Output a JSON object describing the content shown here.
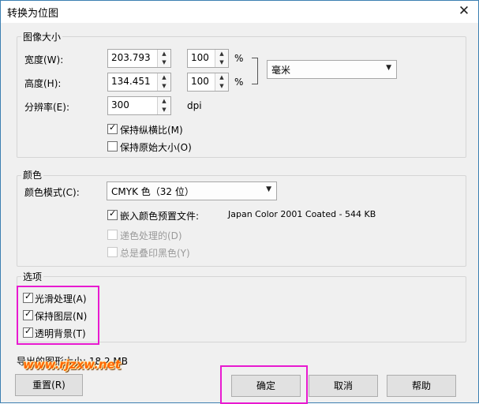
{
  "dialog": {
    "title": "转换为位图",
    "close_glyph": "✕"
  },
  "image_size": {
    "group_title": "图像大小",
    "width_label": "宽度(W):",
    "width_value": "203.793",
    "width_percent": "100",
    "height_label": "高度(H):",
    "height_value": "134.451",
    "height_percent": "100",
    "percent_sign": "%",
    "unit_value": "毫米",
    "resolution_label": "分辨率(E):",
    "resolution_value": "300",
    "resolution_unit": "dpi",
    "keep_ratio_label": "保持纵横比(M)",
    "keep_ratio_checked": true,
    "keep_original_label": "保持原始大小(O)",
    "keep_original_checked": false
  },
  "color": {
    "group_title": "颜色",
    "mode_label": "颜色模式(C):",
    "mode_value": "CMYK 色（32 位）",
    "embed_profile_label": "嵌入颜色预置文件:",
    "embed_profile_checked": true,
    "profile_name": "Japan Color 2001 Coated - 544 KB",
    "dither_label": "递色处理的(D)",
    "dither_checked": false,
    "overprint_label": "总是叠印黑色(Y)",
    "overprint_checked": false
  },
  "options": {
    "group_title": "选项",
    "smooth_label": "光滑处理(A)",
    "smooth_checked": true,
    "keep_layers_label": "保持图层(N)",
    "keep_layers_checked": true,
    "transparent_label": "透明背景(T)",
    "transparent_checked": true
  },
  "export_size_text": "导出的图形大小: 18.2 MB",
  "watermark_text": "www.rjzxw.net",
  "buttons": {
    "reset": "重置(R)",
    "ok": "确定",
    "cancel": "取消",
    "help": "帮助"
  },
  "arrows": {
    "up": "▲",
    "down": "▼",
    "caret": "▼"
  },
  "colors": {
    "highlight": "#e81ad0",
    "watermark": "#ff6600",
    "border": "#3c7fb1"
  }
}
